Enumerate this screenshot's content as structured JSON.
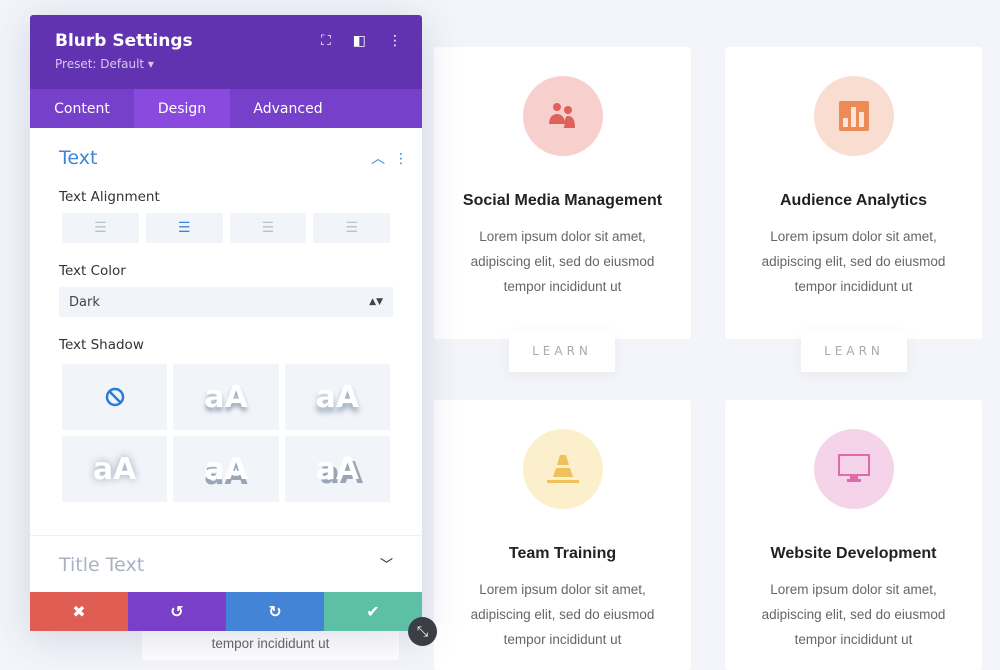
{
  "panel": {
    "title": "Blurb Settings",
    "preset": "Preset: Default ▾",
    "tabs": [
      "Content",
      "Design",
      "Advanced"
    ],
    "section": "Text",
    "alignment_label": "Text Alignment",
    "color_label": "Text Color",
    "color_value": "Dark",
    "shadow_label": "Text Shadow",
    "shadow_sample": "aA",
    "next_section": "Title Text"
  },
  "colors": {
    "header": "#6233b1",
    "tabs": "#7640cb",
    "cancel": "#e05d54",
    "undo": "#7a3fc9",
    "redo": "#4384d6",
    "save": "#5dc0a6"
  },
  "cards": [
    {
      "title": "Social Media Management",
      "body": "Lorem ipsum dolor sit amet, adipiscing elit, sed do eiusmod tempor incididunt ut",
      "button": "LEARN",
      "icon": "users-icon"
    },
    {
      "title": "Audience Analytics",
      "body": "Lorem ipsum dolor sit amet, adipiscing elit, sed do eiusmod tempor incididunt ut",
      "button": "LEARN",
      "icon": "bar-chart-icon"
    },
    {
      "title": "Team Training",
      "body": "Lorem ipsum dolor sit amet, adipiscing elit, sed do eiusmod tempor incididunt ut",
      "icon": "cone-icon"
    },
    {
      "title": "Website Development",
      "body": "Lorem ipsum dolor sit amet, adipiscing elit, sed do eiusmod tempor incididunt ut",
      "icon": "monitor-icon"
    }
  ],
  "hidden_card_text": "tempor incididunt ut"
}
